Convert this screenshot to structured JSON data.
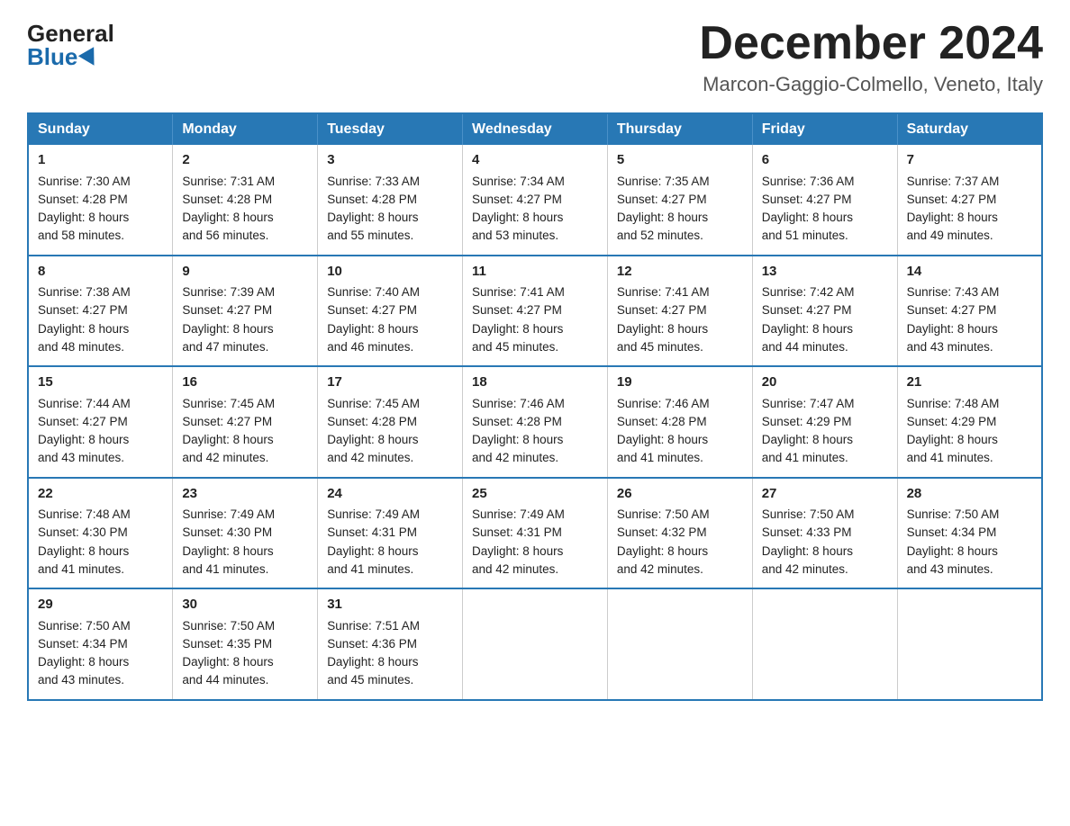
{
  "logo": {
    "general": "General",
    "blue": "Blue"
  },
  "title": "December 2024",
  "location": "Marcon-Gaggio-Colmello, Veneto, Italy",
  "days_of_week": [
    "Sunday",
    "Monday",
    "Tuesday",
    "Wednesday",
    "Thursday",
    "Friday",
    "Saturday"
  ],
  "weeks": [
    [
      {
        "day": "1",
        "sunrise": "Sunrise: 7:30 AM",
        "sunset": "Sunset: 4:28 PM",
        "daylight": "Daylight: 8 hours",
        "daylight2": "and 58 minutes."
      },
      {
        "day": "2",
        "sunrise": "Sunrise: 7:31 AM",
        "sunset": "Sunset: 4:28 PM",
        "daylight": "Daylight: 8 hours",
        "daylight2": "and 56 minutes."
      },
      {
        "day": "3",
        "sunrise": "Sunrise: 7:33 AM",
        "sunset": "Sunset: 4:28 PM",
        "daylight": "Daylight: 8 hours",
        "daylight2": "and 55 minutes."
      },
      {
        "day": "4",
        "sunrise": "Sunrise: 7:34 AM",
        "sunset": "Sunset: 4:27 PM",
        "daylight": "Daylight: 8 hours",
        "daylight2": "and 53 minutes."
      },
      {
        "day": "5",
        "sunrise": "Sunrise: 7:35 AM",
        "sunset": "Sunset: 4:27 PM",
        "daylight": "Daylight: 8 hours",
        "daylight2": "and 52 minutes."
      },
      {
        "day": "6",
        "sunrise": "Sunrise: 7:36 AM",
        "sunset": "Sunset: 4:27 PM",
        "daylight": "Daylight: 8 hours",
        "daylight2": "and 51 minutes."
      },
      {
        "day": "7",
        "sunrise": "Sunrise: 7:37 AM",
        "sunset": "Sunset: 4:27 PM",
        "daylight": "Daylight: 8 hours",
        "daylight2": "and 49 minutes."
      }
    ],
    [
      {
        "day": "8",
        "sunrise": "Sunrise: 7:38 AM",
        "sunset": "Sunset: 4:27 PM",
        "daylight": "Daylight: 8 hours",
        "daylight2": "and 48 minutes."
      },
      {
        "day": "9",
        "sunrise": "Sunrise: 7:39 AM",
        "sunset": "Sunset: 4:27 PM",
        "daylight": "Daylight: 8 hours",
        "daylight2": "and 47 minutes."
      },
      {
        "day": "10",
        "sunrise": "Sunrise: 7:40 AM",
        "sunset": "Sunset: 4:27 PM",
        "daylight": "Daylight: 8 hours",
        "daylight2": "and 46 minutes."
      },
      {
        "day": "11",
        "sunrise": "Sunrise: 7:41 AM",
        "sunset": "Sunset: 4:27 PM",
        "daylight": "Daylight: 8 hours",
        "daylight2": "and 45 minutes."
      },
      {
        "day": "12",
        "sunrise": "Sunrise: 7:41 AM",
        "sunset": "Sunset: 4:27 PM",
        "daylight": "Daylight: 8 hours",
        "daylight2": "and 45 minutes."
      },
      {
        "day": "13",
        "sunrise": "Sunrise: 7:42 AM",
        "sunset": "Sunset: 4:27 PM",
        "daylight": "Daylight: 8 hours",
        "daylight2": "and 44 minutes."
      },
      {
        "day": "14",
        "sunrise": "Sunrise: 7:43 AM",
        "sunset": "Sunset: 4:27 PM",
        "daylight": "Daylight: 8 hours",
        "daylight2": "and 43 minutes."
      }
    ],
    [
      {
        "day": "15",
        "sunrise": "Sunrise: 7:44 AM",
        "sunset": "Sunset: 4:27 PM",
        "daylight": "Daylight: 8 hours",
        "daylight2": "and 43 minutes."
      },
      {
        "day": "16",
        "sunrise": "Sunrise: 7:45 AM",
        "sunset": "Sunset: 4:27 PM",
        "daylight": "Daylight: 8 hours",
        "daylight2": "and 42 minutes."
      },
      {
        "day": "17",
        "sunrise": "Sunrise: 7:45 AM",
        "sunset": "Sunset: 4:28 PM",
        "daylight": "Daylight: 8 hours",
        "daylight2": "and 42 minutes."
      },
      {
        "day": "18",
        "sunrise": "Sunrise: 7:46 AM",
        "sunset": "Sunset: 4:28 PM",
        "daylight": "Daylight: 8 hours",
        "daylight2": "and 42 minutes."
      },
      {
        "day": "19",
        "sunrise": "Sunrise: 7:46 AM",
        "sunset": "Sunset: 4:28 PM",
        "daylight": "Daylight: 8 hours",
        "daylight2": "and 41 minutes."
      },
      {
        "day": "20",
        "sunrise": "Sunrise: 7:47 AM",
        "sunset": "Sunset: 4:29 PM",
        "daylight": "Daylight: 8 hours",
        "daylight2": "and 41 minutes."
      },
      {
        "day": "21",
        "sunrise": "Sunrise: 7:48 AM",
        "sunset": "Sunset: 4:29 PM",
        "daylight": "Daylight: 8 hours",
        "daylight2": "and 41 minutes."
      }
    ],
    [
      {
        "day": "22",
        "sunrise": "Sunrise: 7:48 AM",
        "sunset": "Sunset: 4:30 PM",
        "daylight": "Daylight: 8 hours",
        "daylight2": "and 41 minutes."
      },
      {
        "day": "23",
        "sunrise": "Sunrise: 7:49 AM",
        "sunset": "Sunset: 4:30 PM",
        "daylight": "Daylight: 8 hours",
        "daylight2": "and 41 minutes."
      },
      {
        "day": "24",
        "sunrise": "Sunrise: 7:49 AM",
        "sunset": "Sunset: 4:31 PM",
        "daylight": "Daylight: 8 hours",
        "daylight2": "and 41 minutes."
      },
      {
        "day": "25",
        "sunrise": "Sunrise: 7:49 AM",
        "sunset": "Sunset: 4:31 PM",
        "daylight": "Daylight: 8 hours",
        "daylight2": "and 42 minutes."
      },
      {
        "day": "26",
        "sunrise": "Sunrise: 7:50 AM",
        "sunset": "Sunset: 4:32 PM",
        "daylight": "Daylight: 8 hours",
        "daylight2": "and 42 minutes."
      },
      {
        "day": "27",
        "sunrise": "Sunrise: 7:50 AM",
        "sunset": "Sunset: 4:33 PM",
        "daylight": "Daylight: 8 hours",
        "daylight2": "and 42 minutes."
      },
      {
        "day": "28",
        "sunrise": "Sunrise: 7:50 AM",
        "sunset": "Sunset: 4:34 PM",
        "daylight": "Daylight: 8 hours",
        "daylight2": "and 43 minutes."
      }
    ],
    [
      {
        "day": "29",
        "sunrise": "Sunrise: 7:50 AM",
        "sunset": "Sunset: 4:34 PM",
        "daylight": "Daylight: 8 hours",
        "daylight2": "and 43 minutes."
      },
      {
        "day": "30",
        "sunrise": "Sunrise: 7:50 AM",
        "sunset": "Sunset: 4:35 PM",
        "daylight": "Daylight: 8 hours",
        "daylight2": "and 44 minutes."
      },
      {
        "day": "31",
        "sunrise": "Sunrise: 7:51 AM",
        "sunset": "Sunset: 4:36 PM",
        "daylight": "Daylight: 8 hours",
        "daylight2": "and 45 minutes."
      },
      null,
      null,
      null,
      null
    ]
  ]
}
